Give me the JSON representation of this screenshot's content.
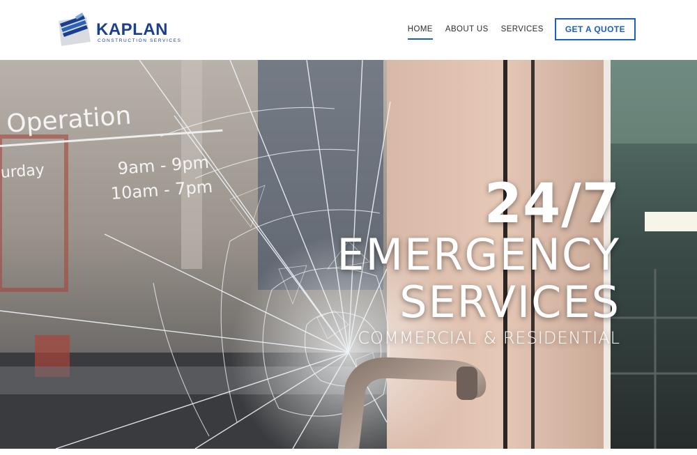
{
  "brand": {
    "name": "KAPLAN",
    "tagline": "CONSTRUCTION SERVICES",
    "color": "#1a3f8f"
  },
  "nav": {
    "items": [
      {
        "label": "HOME",
        "active": true
      },
      {
        "label": "ABOUT US",
        "active": false
      },
      {
        "label": "SERVICES",
        "active": false
      }
    ],
    "cta_label": "GET A QUOTE",
    "accent": "#1a5fb8"
  },
  "hero": {
    "big_number": "24/7",
    "headline_line1": "EMERGENCY",
    "headline_line2": "SERVICES",
    "subline": "COMMERCIAL & RESIDENTIAL",
    "image_alt": "shattered glass door with metal handle",
    "sign": {
      "title": "Operation",
      "day": "urday",
      "hours1": "9am - 9pm",
      "hours2": "10am - 7pm"
    }
  }
}
